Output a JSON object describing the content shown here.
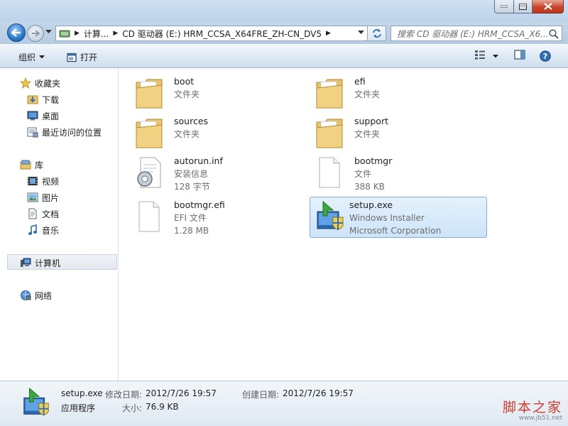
{
  "address": {
    "crumbs": [
      "计算...",
      "CD 驱动器 (E:) HRM_CCSA_X64FRE_ZH-CN_DV5"
    ]
  },
  "search": {
    "placeholder": "搜索 CD 驱动器 (E:) HRM_CCSA_X6..."
  },
  "toolbar": {
    "organize_label": "组织",
    "open_label": "打开"
  },
  "navpane": {
    "favorites": {
      "label": "收藏夹",
      "items": [
        "下载",
        "桌面",
        "最近访问的位置"
      ]
    },
    "libraries": {
      "label": "库",
      "items": [
        "视频",
        "图片",
        "文档",
        "音乐"
      ]
    },
    "computer": "计算机",
    "network": "网络"
  },
  "files": [
    {
      "name": "boot",
      "line1": "文件夹",
      "line2": "",
      "icon": "folder-icon"
    },
    {
      "name": "efi",
      "line1": "文件夹",
      "line2": "",
      "icon": "folder-icon"
    },
    {
      "name": "sources",
      "line1": "文件夹",
      "line2": "",
      "icon": "folder-icon"
    },
    {
      "name": "support",
      "line1": "文件夹",
      "line2": "",
      "icon": "folder-icon"
    },
    {
      "name": "autorun.inf",
      "line1": "安装信息",
      "line2": "128 字节",
      "icon": "setup-info-icon"
    },
    {
      "name": "bootmgr",
      "line1": "文件",
      "line2": "388 KB",
      "icon": "file-icon"
    },
    {
      "name": "bootmgr.efi",
      "line1": "EFI 文件",
      "line2": "1.28 MB",
      "icon": "file-icon"
    },
    {
      "name": "setup.exe",
      "line1": "Windows Installer",
      "line2": "Microsoft Corporation",
      "icon": "setup-exe-icon",
      "selected": true
    }
  ],
  "details": {
    "name": "setup.exe",
    "type": "应用程序",
    "modified_label": "修改日期:",
    "modified": "2012/7/26 19:57",
    "created_label": "创建日期:",
    "created": "2012/7/26 19:57",
    "size_label": "大小:",
    "size": "76.9 KB"
  },
  "watermark": {
    "title": "脚本之家",
    "url": "www.jb51.net"
  },
  "colors": {
    "selection": "#cde4f8",
    "selection_border": "#84acdd",
    "watermark": "#d23c2c"
  }
}
